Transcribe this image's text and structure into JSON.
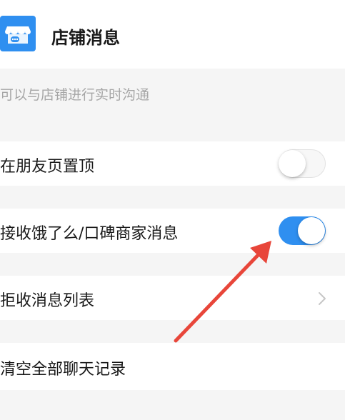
{
  "header": {
    "title": "店铺消息",
    "icon": "store-chat-icon"
  },
  "description": "可以与店铺进行实时沟通",
  "settings": [
    {
      "label": "在朋友页置顶",
      "control": "toggle",
      "on": false
    },
    {
      "label": "接收饿了么/口碑商家消息",
      "control": "toggle",
      "on": true
    },
    {
      "label": "拒收消息列表",
      "control": "chevron-right-icon"
    },
    {
      "label": "清空全部聊天记录",
      "control": "none"
    }
  ],
  "colors": {
    "accent": "#2f8ff0",
    "annotation_arrow": "#e8463a"
  }
}
